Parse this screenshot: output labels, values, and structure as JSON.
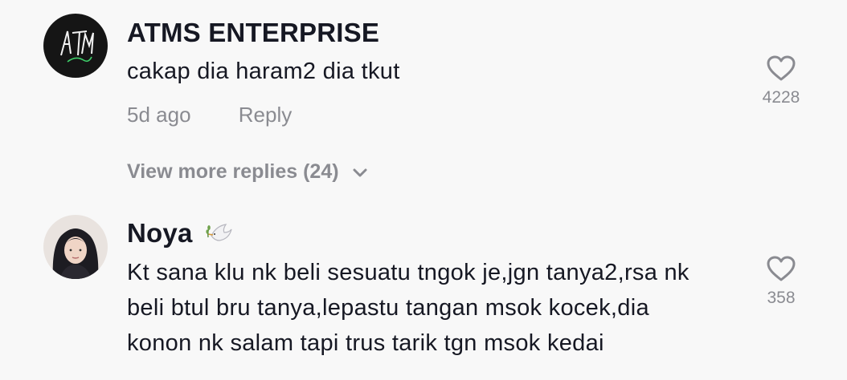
{
  "comments": [
    {
      "username": "ATMS ENTERPRISE",
      "text_lines": [
        "cakap dia haram2 dia tkut"
      ],
      "time": "5d ago",
      "reply_label": "Reply",
      "likes": "4228",
      "avatar_icon": "atms-logo-icon",
      "view_more": "View more replies (24)"
    },
    {
      "username": "Noya",
      "username_badge_icon": "dove-olive-branch-icon",
      "text_lines": [
        "Kt sana klu nk beli sesuatu tngok je,jgn tanya2,rsa nk",
        "beli btul bru tanya,lepastu tangan msok kocek,dia",
        "konon nk salam tapi trus tarik tgn msok kedai"
      ],
      "likes": "358",
      "avatar_icon": "profile-photo"
    }
  ],
  "colors": {
    "background": "#f8f8f8",
    "primary_text": "#161823",
    "secondary_text": "#8a8b91"
  }
}
